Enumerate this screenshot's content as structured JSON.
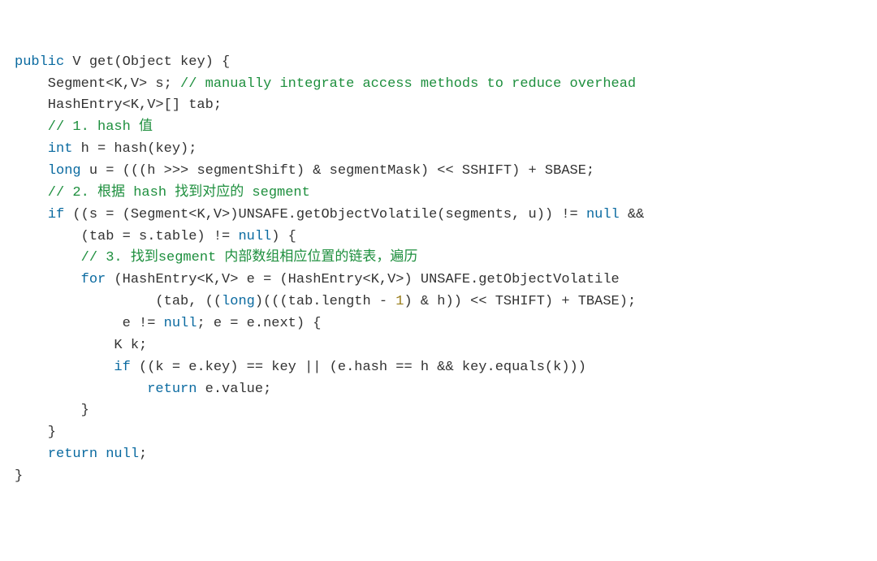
{
  "code": {
    "l1a": "public",
    "l1b": " V get(Object key) {",
    "l2a": "    Segment<K,V> s; ",
    "l2b": "// manually integrate access methods to reduce overhead",
    "l3": "    HashEntry<K,V>[] tab;",
    "l4": "    // 1. hash 值",
    "l5a": "    ",
    "l5b": "int",
    "l5c": " h = hash(key);",
    "l6a": "    ",
    "l6b": "long",
    "l6c": " u = (((h >>> segmentShift) & segmentMask) << SSHIFT) + SBASE;",
    "l7": "    // 2. 根据 hash 找到对应的 segment",
    "l8a": "    ",
    "l8b": "if",
    "l8c": " ((s = (Segment<K,V>)UNSAFE.getObjectVolatile(segments, u)) != ",
    "l8d": "null",
    "l8e": " &&",
    "l9a": "        (tab = s.table) != ",
    "l9b": "null",
    "l9c": ") {",
    "l10": "        // 3. 找到segment 内部数组相应位置的链表，遍历",
    "l11a": "        ",
    "l11b": "for",
    "l11c": " (HashEntry<K,V> e = (HashEntry<K,V>) UNSAFE.getObjectVolatile",
    "l12a": "                 (tab, ((",
    "l12b": "long",
    "l12c": ")(((tab.length - ",
    "l12d": "1",
    "l12e": ") & h)) << TSHIFT) + TBASE);",
    "l13a": "             e != ",
    "l13b": "null",
    "l13c": "; e = e.next) {",
    "l14": "            K k;",
    "l15a": "            ",
    "l15b": "if",
    "l15c": " ((k = e.key) == key || (e.hash == h && key.equals(k)))",
    "l16a": "                ",
    "l16b": "return",
    "l16c": " e.value;",
    "l17": "        }",
    "l18": "    }",
    "l19a": "    ",
    "l19b": "return null",
    "l19c": ";",
    "l20": "}"
  }
}
